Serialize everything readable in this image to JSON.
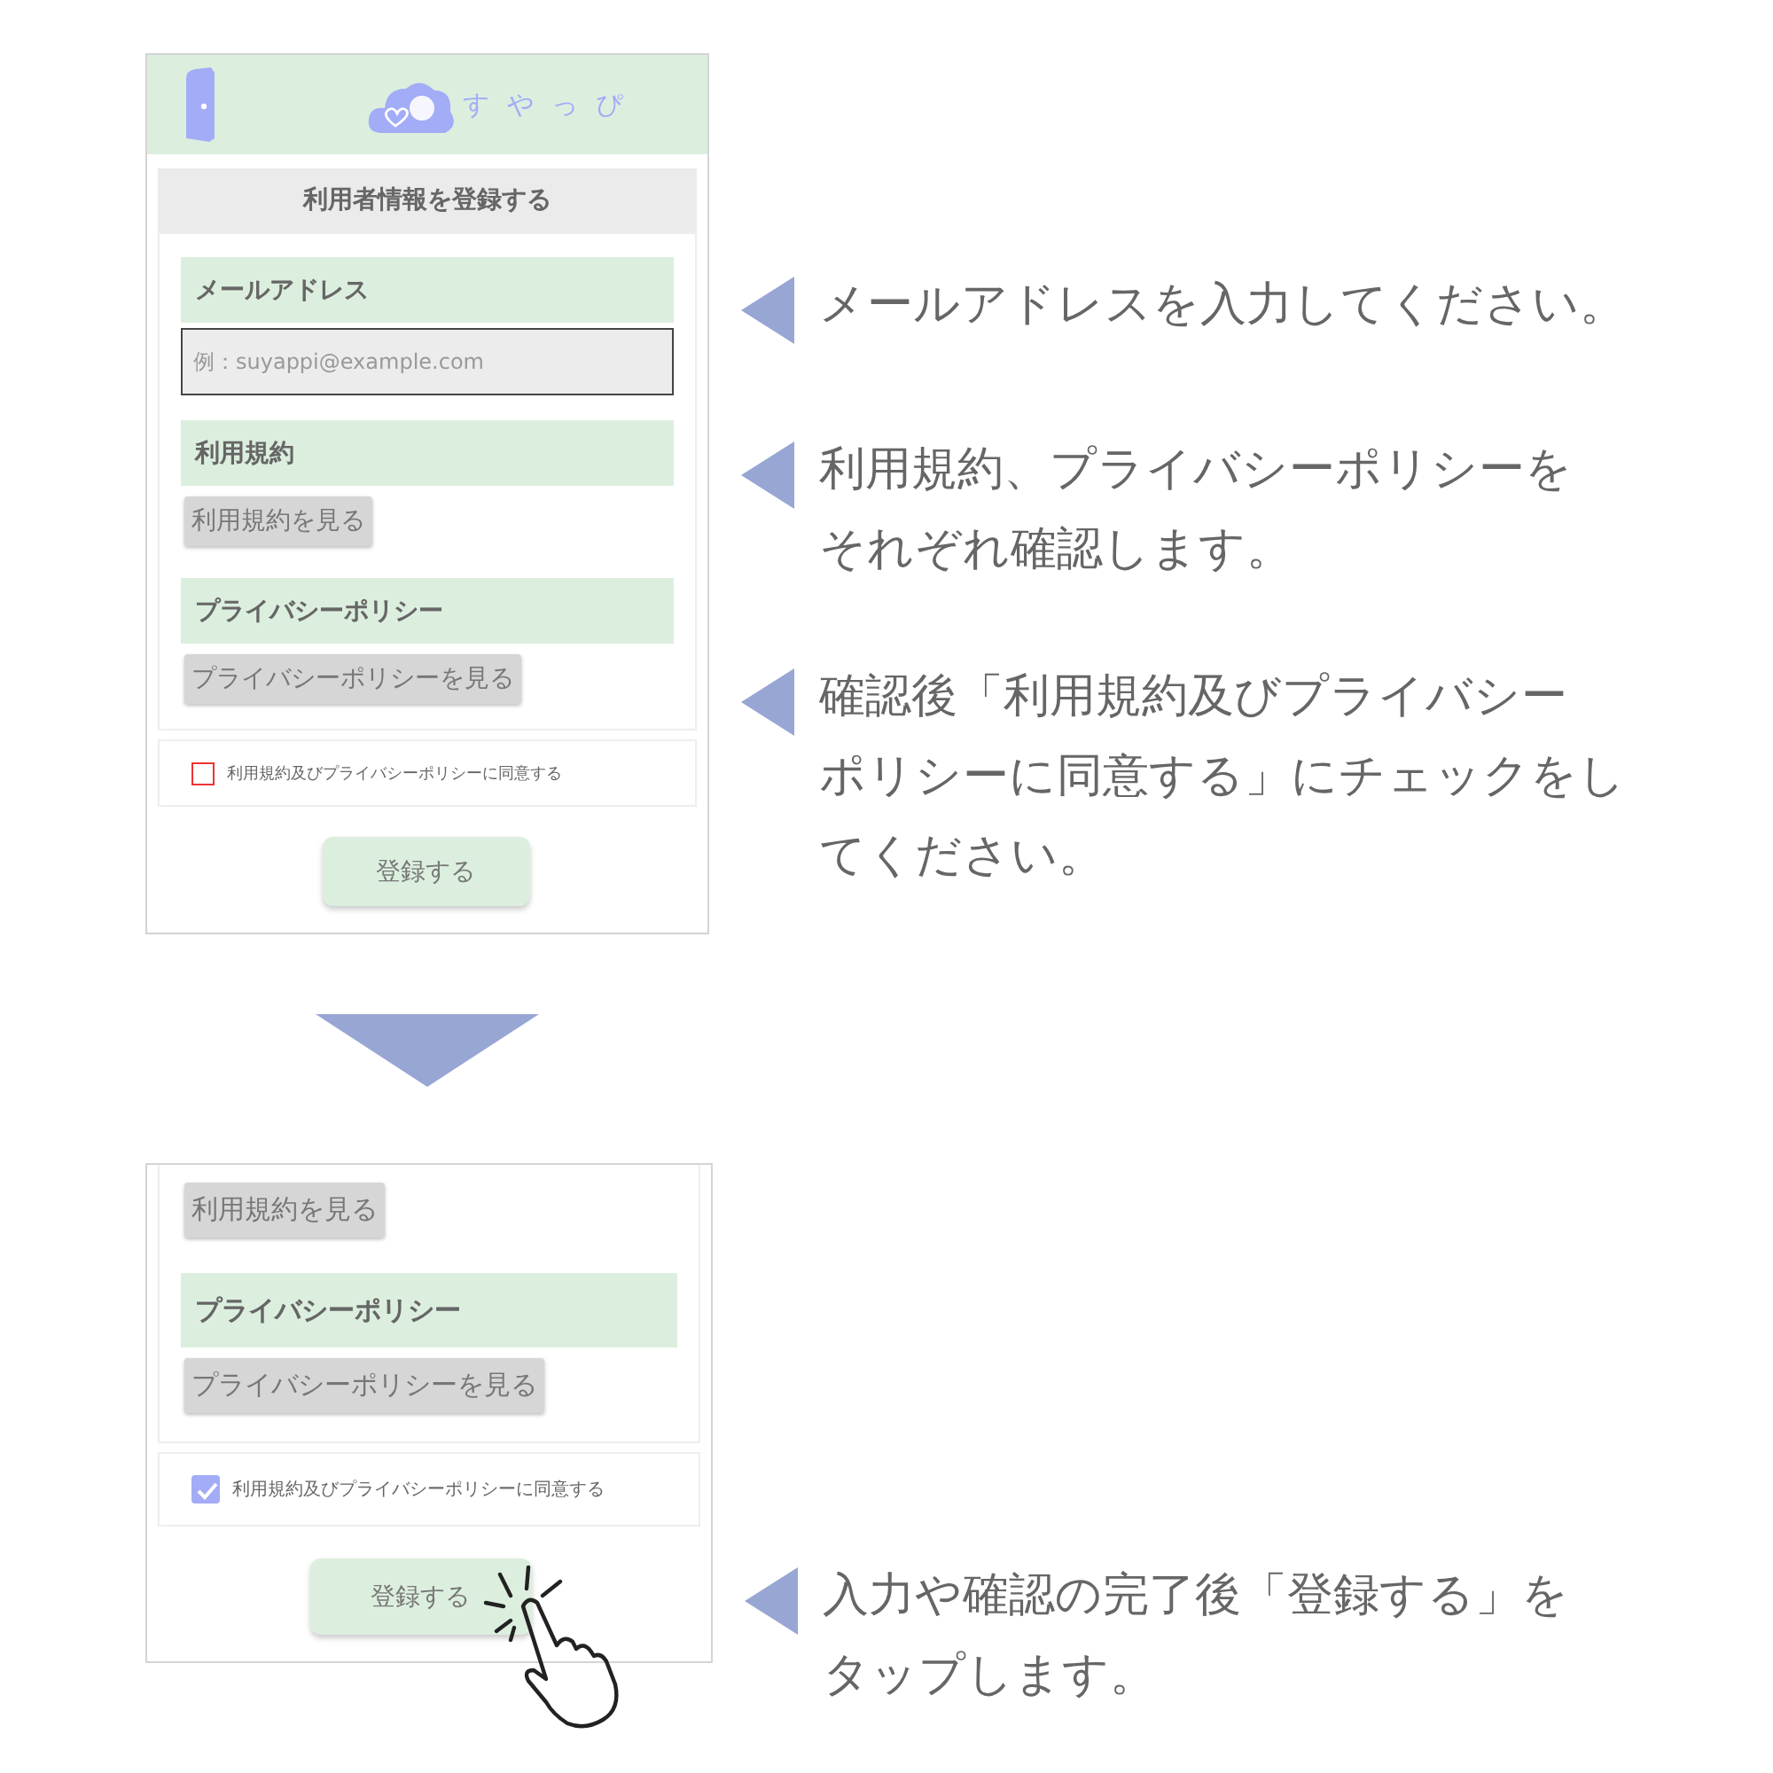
{
  "screens": [
    {
      "kind": "full",
      "header": {
        "logo_text": "すやっぴ"
      },
      "title": "利用者情報を登録する",
      "sections": [
        {
          "heading": "メールアドレス",
          "field": {
            "placeholder": "例：suyappi@example.com"
          }
        },
        {
          "heading": "利用規約",
          "button": "利用規約を見る"
        },
        {
          "heading": "プライバシーポリシー",
          "button": "プライバシーポリシーを見る"
        }
      ],
      "agree": {
        "label": "利用規約及びプライバシーポリシーに同意する",
        "checked": false
      },
      "submit": "登録する",
      "tap": false,
      "notes": [
        {
          "lines": [
            "メールアドレスを入力してください。"
          ]
        },
        {
          "lines": [
            "利用規約、プライバシーポリシーを",
            "それぞれ確認します。"
          ]
        },
        {
          "lines": [
            "確認後「利用規約及びプライバシー",
            "ポリシーに同意する」にチェックをし",
            "てください。"
          ]
        }
      ]
    },
    {
      "kind": "scrolled",
      "sections": [
        {
          "button": "利用規約を見る"
        },
        {
          "heading": "プライバシーポリシー",
          "button": "プライバシーポリシーを見る"
        }
      ],
      "agree": {
        "label": "利用規約及びプライバシーポリシーに同意する",
        "checked": true
      },
      "submit": "登録する",
      "tap": true,
      "notes": [
        {
          "lines": [
            "入力や確認の完了後「登録する」を",
            "タップします。"
          ]
        }
      ]
    }
  ]
}
